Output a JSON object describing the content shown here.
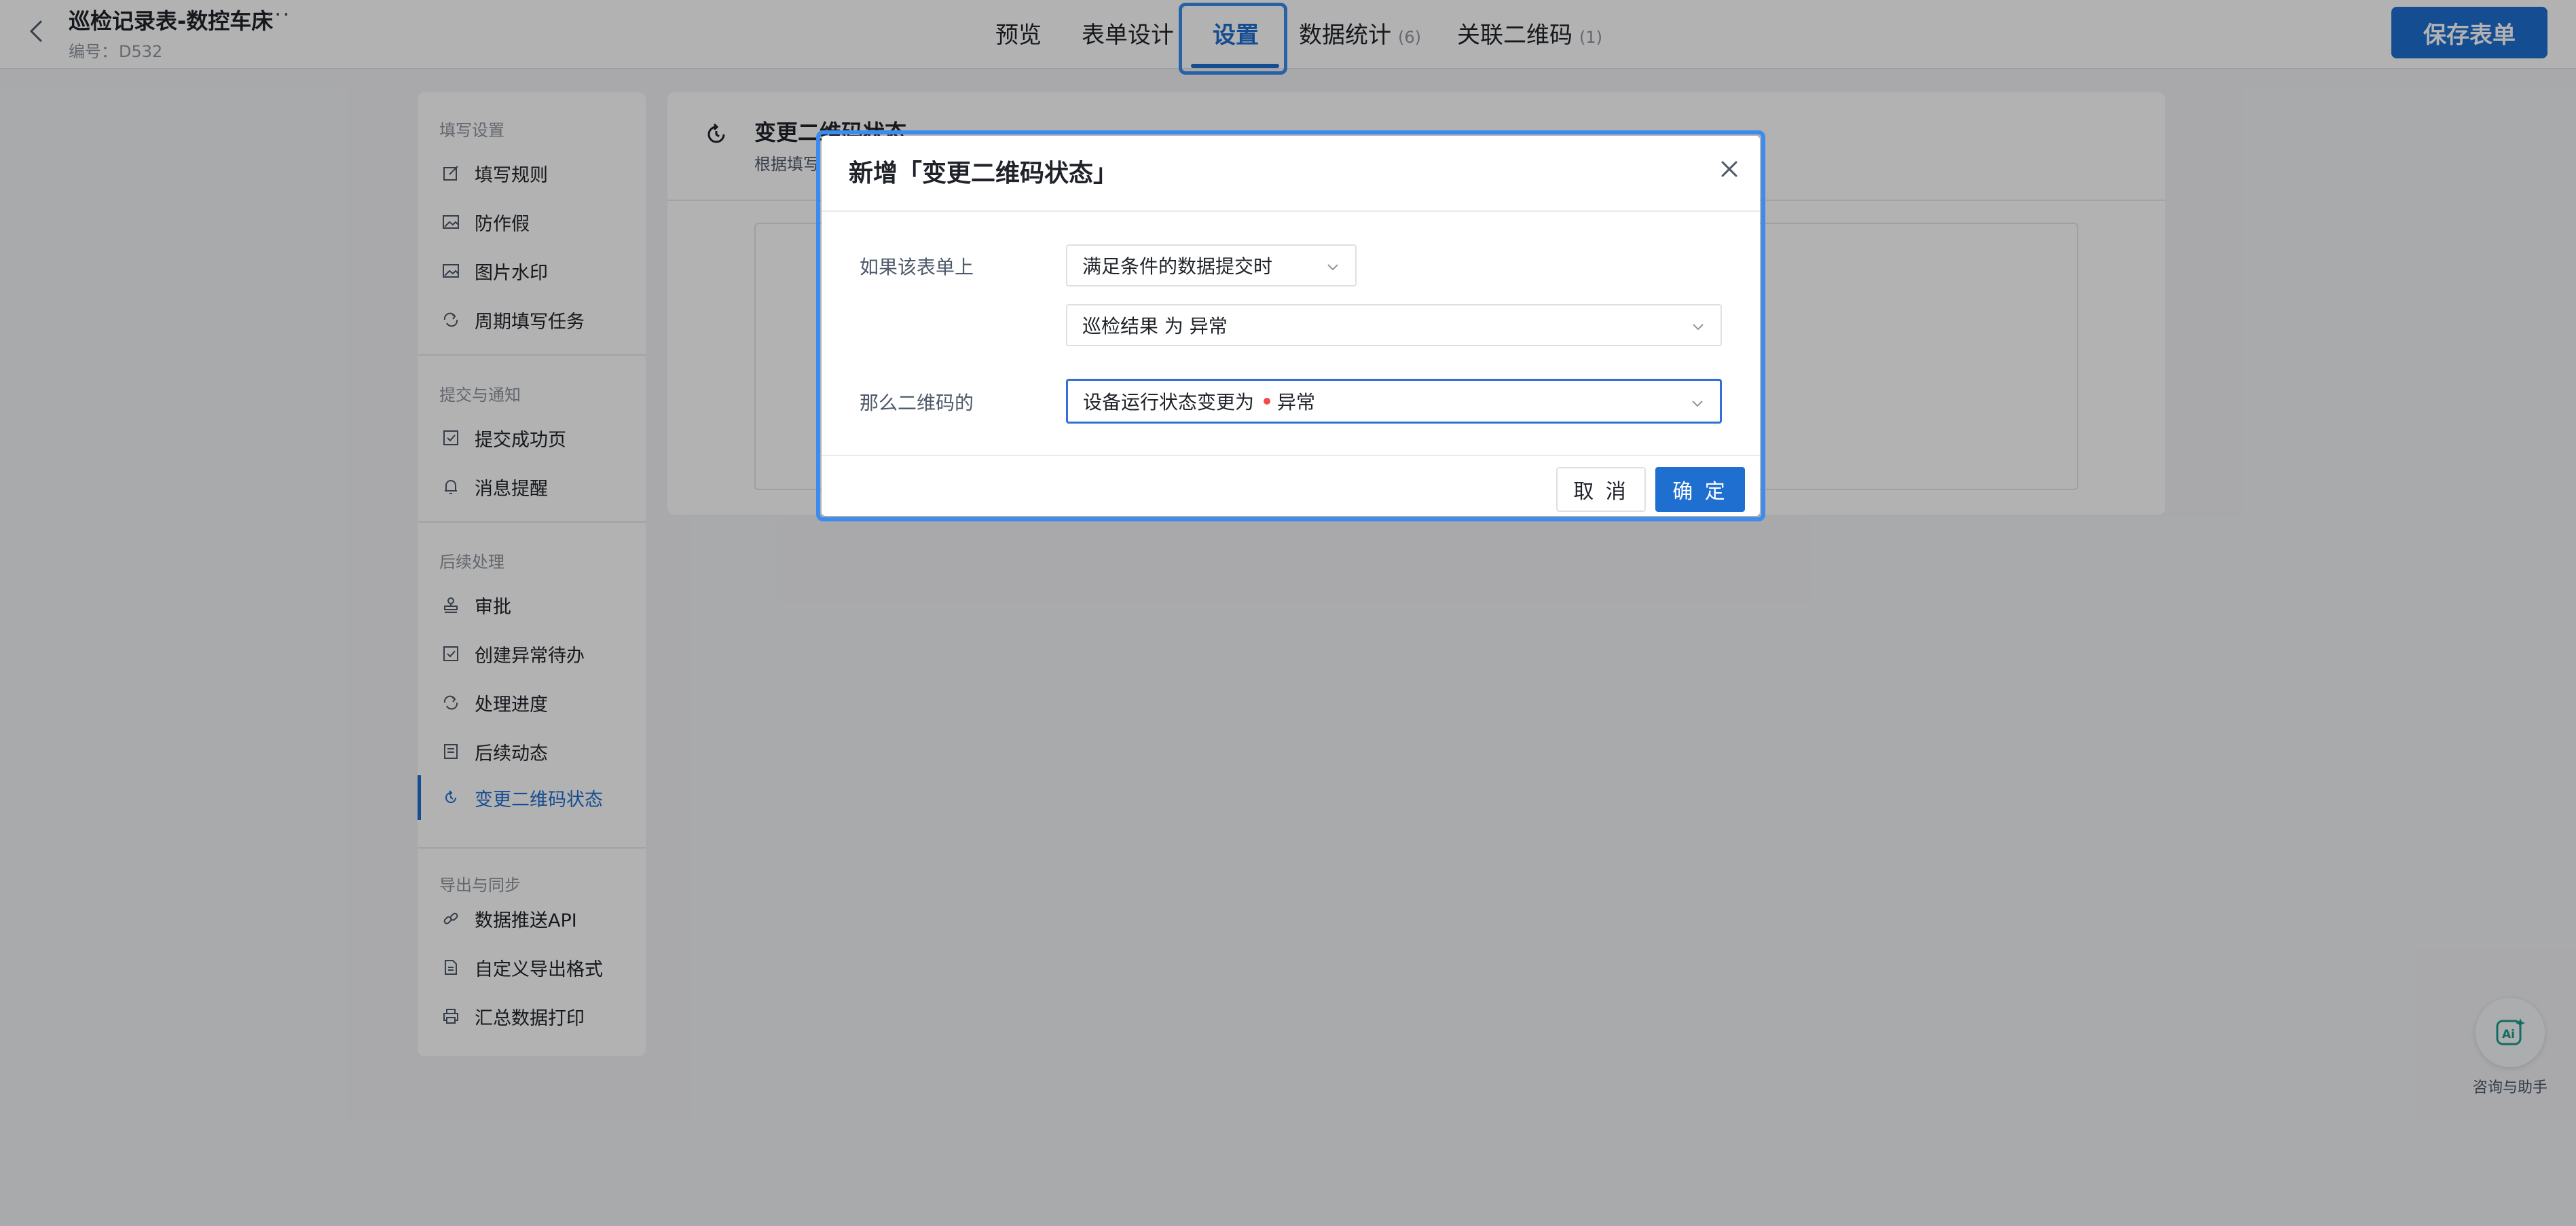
{
  "header": {
    "title": "巡检记录表-数控车床",
    "more": "···",
    "code_label": "编号：",
    "code_value": "D532",
    "save_label": "保存表单"
  },
  "tabs": [
    {
      "label": "预览"
    },
    {
      "label": "表单设计"
    },
    {
      "label": "设置"
    },
    {
      "label": "数据统计",
      "count": "(6)"
    },
    {
      "label": "关联二维码",
      "count": "(1)"
    }
  ],
  "sidebar": {
    "groups": [
      {
        "title": "填写设置",
        "items": [
          {
            "label": "填写规则",
            "icon": "edit-icon"
          },
          {
            "label": "防作假",
            "icon": "image-icon"
          },
          {
            "label": "图片水印",
            "icon": "image-icon"
          },
          {
            "label": "周期填写任务",
            "icon": "repeat-icon"
          }
        ]
      },
      {
        "title": "提交与通知",
        "items": [
          {
            "label": "提交成功页",
            "icon": "check-square-icon"
          },
          {
            "label": "消息提醒",
            "icon": "bell-icon"
          }
        ]
      },
      {
        "title": "后续处理",
        "items": [
          {
            "label": "审批",
            "icon": "stamp-icon"
          },
          {
            "label": "创建异常待办",
            "icon": "check-square-icon"
          },
          {
            "label": "处理进度",
            "icon": "repeat-icon"
          },
          {
            "label": "后续动态",
            "icon": "document-icon"
          },
          {
            "label": "变更二维码状态",
            "icon": "refresh-icon"
          }
        ]
      },
      {
        "title": "导出与同步",
        "items": [
          {
            "label": "数据推送API",
            "icon": "link-icon"
          },
          {
            "label": "自定义导出格式",
            "icon": "file-icon"
          },
          {
            "label": "汇总数据打印",
            "icon": "printer-icon"
          }
        ]
      }
    ]
  },
  "main": {
    "title": "变更二维码状态",
    "desc": "根据填写"
  },
  "dialog": {
    "title": "新增「变更二维码状态」",
    "if_label": "如果该表单上",
    "trigger_value": "满足条件的数据提交时",
    "condition_value": "巡检结果 为 异常",
    "then_label": "那么二维码的",
    "action_prefix": "设备运行状态变更为",
    "action_value": "异常",
    "status_color": "#f54a45",
    "cancel_label": "取 消",
    "ok_label": "确 定"
  },
  "assistant": {
    "label": "咨询与助手"
  },
  "colors": {
    "accent": "#1f6fd1",
    "highlight": "#3c8cf0"
  }
}
